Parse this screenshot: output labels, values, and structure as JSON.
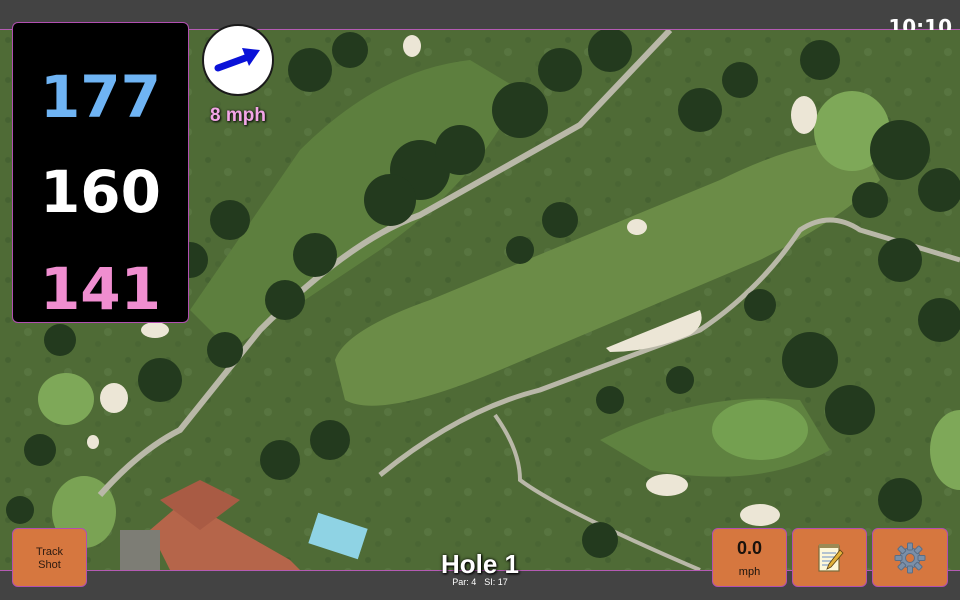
{
  "status_bar": {
    "clock": "10:10"
  },
  "distances": {
    "back": "177",
    "middle": "160",
    "front": "141"
  },
  "wind": {
    "speed": "8 mph",
    "direction_icon": "wind-arrow-icon"
  },
  "hole": {
    "title": "Hole 1",
    "par": "Par: 4",
    "stroke_index": "SI: 17"
  },
  "buttons": {
    "track_shot": "Track\nShot",
    "speed_value": "0.0",
    "speed_unit": "mph",
    "notes_icon": "notepad-icon",
    "settings_icon": "gear-icon"
  },
  "colors": {
    "back_distance": "#6fb4f4",
    "middle_distance": "#ffffff",
    "front_distance": "#f08ed0",
    "wind_text": "#f3a6e6",
    "button": "#d6773f",
    "accent_border": "#b14fb1",
    "bar": "#434343"
  }
}
